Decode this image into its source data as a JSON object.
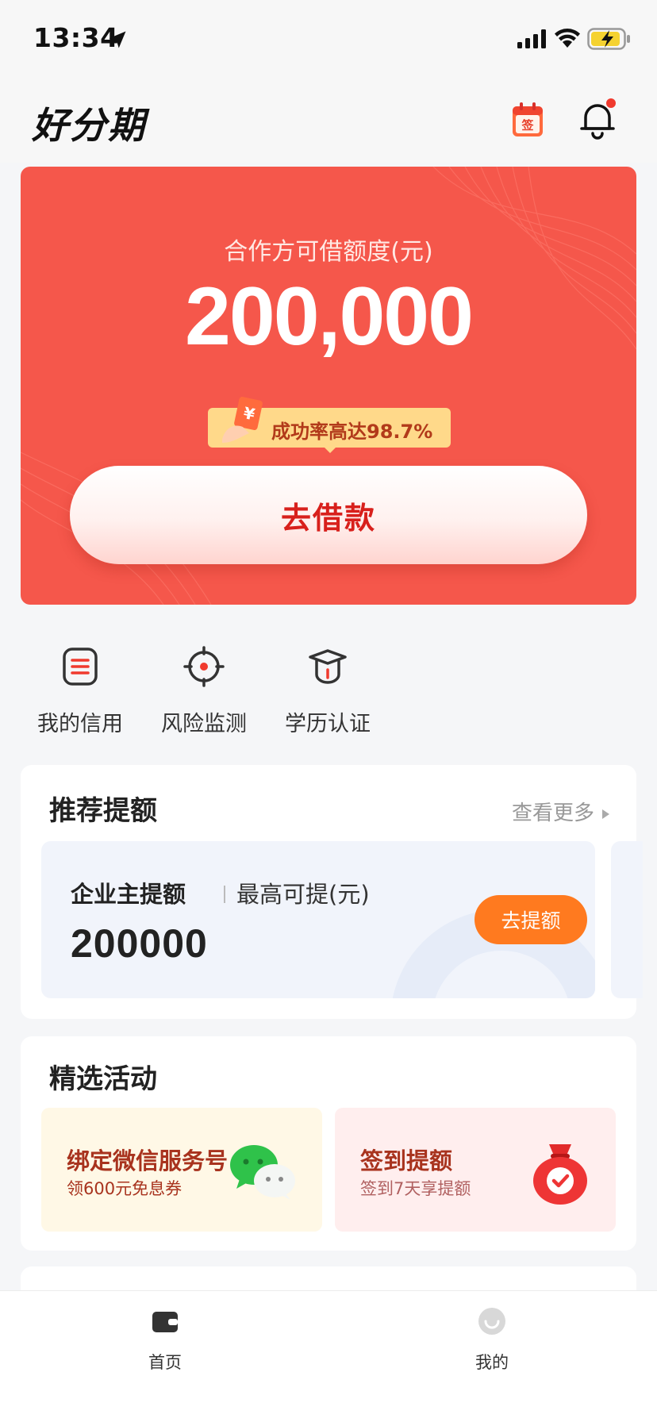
{
  "status_bar": {
    "time": "13:34"
  },
  "header": {
    "logo": "好分期"
  },
  "hero": {
    "label": "合作方可借额度(元)",
    "amount": "200,000",
    "success_text": "成功率高达98.7%",
    "borrow_button": "去借款"
  },
  "shortcuts": [
    {
      "label": "我的信用",
      "icon": "credit-icon"
    },
    {
      "label": "风险监测",
      "icon": "target-icon"
    },
    {
      "label": "学历认证",
      "icon": "graduation-cap-icon"
    }
  ],
  "recommend": {
    "title": "推荐提额",
    "more": "查看更多",
    "item": {
      "name": "企业主提额",
      "sub": "最高可提(元)",
      "value": "200000",
      "button": "去提额"
    }
  },
  "activities": {
    "title": "精选活动",
    "items": [
      {
        "title": "绑定微信服务号",
        "sub": "领600元免息券",
        "icon": "wechat-icon"
      },
      {
        "title": "签到提额",
        "sub": "签到7天享提额",
        "icon": "lucky-bag-icon"
      }
    ]
  },
  "tab_bar": [
    {
      "label": "首页",
      "icon": "wallet-icon"
    },
    {
      "label": "我的",
      "icon": "profile-icon"
    }
  ],
  "colors": {
    "brand_red": "#f5574b",
    "button_orange": "#ff7a1f",
    "badge_yellow": "#ffd98a"
  }
}
